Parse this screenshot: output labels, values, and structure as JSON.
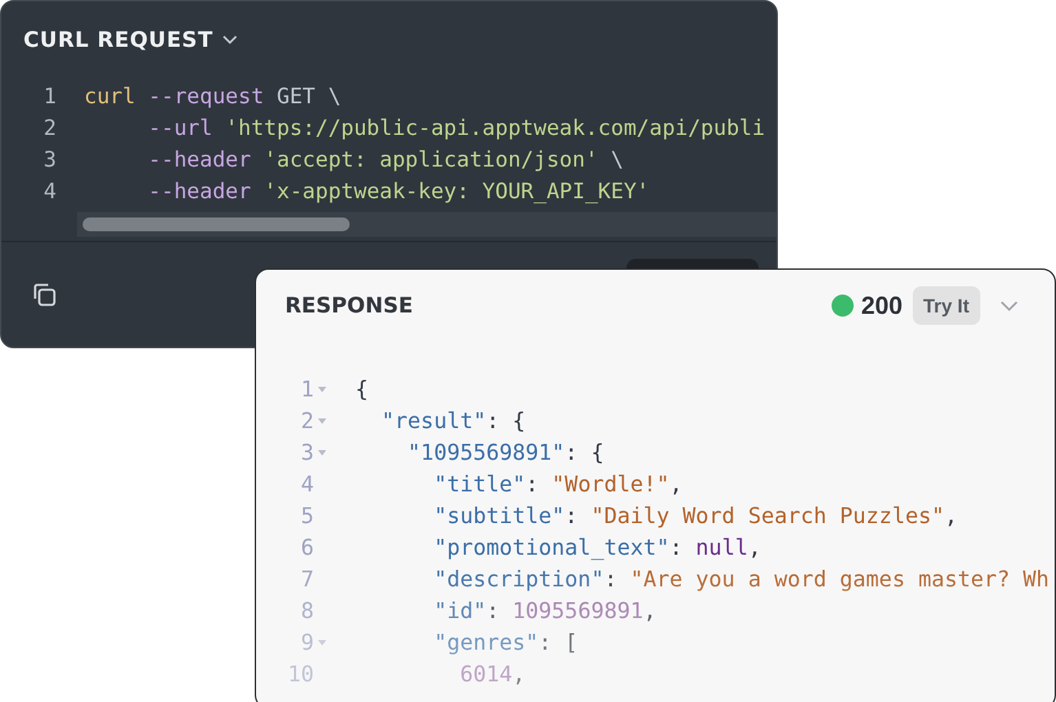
{
  "request": {
    "title": "CURL REQUEST",
    "lines": [
      {
        "number": "1",
        "tokens": [
          {
            "kind": "command",
            "text": "curl"
          },
          {
            "kind": "flag",
            "text": " --request"
          },
          {
            "kind": "plain",
            "text": " GET \\"
          }
        ]
      },
      {
        "number": "2",
        "tokens": [
          {
            "kind": "flag",
            "text": "     --url"
          },
          {
            "kind": "string",
            "text": " 'https://public-api.apptweak.com/api/publi"
          }
        ]
      },
      {
        "number": "3",
        "tokens": [
          {
            "kind": "flag",
            "text": "     --header"
          },
          {
            "kind": "string",
            "text": " 'accept: application/json'"
          },
          {
            "kind": "plain",
            "text": " \\"
          }
        ]
      },
      {
        "number": "4",
        "tokens": [
          {
            "kind": "flag",
            "text": "     --header"
          },
          {
            "kind": "string",
            "text": " 'x-apptweak-key: YOUR_API_KEY'"
          }
        ]
      }
    ]
  },
  "response": {
    "title": "RESPONSE",
    "status": "200",
    "try_button": "Try It",
    "lines": [
      {
        "number": "1",
        "foldable": true,
        "tokens": [
          {
            "kind": "punct",
            "text": "{"
          }
        ]
      },
      {
        "number": "2",
        "foldable": true,
        "tokens": [
          {
            "kind": "key",
            "text": "  \"result\""
          },
          {
            "kind": "punct",
            "text": ": {"
          }
        ]
      },
      {
        "number": "3",
        "foldable": true,
        "tokens": [
          {
            "kind": "key",
            "text": "    \"1095569891\""
          },
          {
            "kind": "punct",
            "text": ": {"
          }
        ]
      },
      {
        "number": "4",
        "foldable": false,
        "tokens": [
          {
            "kind": "key",
            "text": "      \"title\""
          },
          {
            "kind": "punct",
            "text": ": "
          },
          {
            "kind": "string",
            "text": "\"Wordle!\""
          },
          {
            "kind": "punct",
            "text": ","
          }
        ]
      },
      {
        "number": "5",
        "foldable": false,
        "tokens": [
          {
            "kind": "key",
            "text": "      \"subtitle\""
          },
          {
            "kind": "punct",
            "text": ": "
          },
          {
            "kind": "string",
            "text": "\"Daily Word Search Puzzles\""
          },
          {
            "kind": "punct",
            "text": ","
          }
        ]
      },
      {
        "number": "6",
        "foldable": false,
        "tokens": [
          {
            "kind": "key",
            "text": "      \"promotional_text\""
          },
          {
            "kind": "punct",
            "text": ": "
          },
          {
            "kind": "null",
            "text": "null"
          },
          {
            "kind": "punct",
            "text": ","
          }
        ]
      },
      {
        "number": "7",
        "foldable": false,
        "tokens": [
          {
            "kind": "key",
            "text": "      \"description\""
          },
          {
            "kind": "punct",
            "text": ": "
          },
          {
            "kind": "string",
            "text": "\"Are you a word games master? Wh"
          }
        ]
      },
      {
        "number": "8",
        "foldable": false,
        "tokens": [
          {
            "kind": "key",
            "text": "      \"id\""
          },
          {
            "kind": "punct",
            "text": ": "
          },
          {
            "kind": "number",
            "text": "1095569891"
          },
          {
            "kind": "punct",
            "text": ","
          }
        ]
      },
      {
        "number": "9",
        "foldable": true,
        "tokens": [
          {
            "kind": "key",
            "text": "      \"genres\""
          },
          {
            "kind": "punct",
            "text": ": ["
          }
        ]
      },
      {
        "number": "10",
        "foldable": false,
        "tokens": [
          {
            "kind": "number",
            "text": "        6014"
          },
          {
            "kind": "punct",
            "text": ","
          }
        ]
      }
    ]
  }
}
